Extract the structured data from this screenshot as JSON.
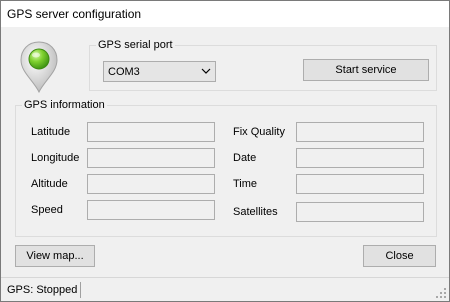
{
  "window": {
    "title": "GPS server configuration"
  },
  "serial": {
    "group_label": "GPS serial port",
    "port_value": "COM3",
    "start_label": "Start service"
  },
  "info": {
    "group_label": "GPS information",
    "left_fields": [
      {
        "label": "Latitude",
        "value": ""
      },
      {
        "label": "Longitude",
        "value": ""
      },
      {
        "label": "Altitude",
        "value": ""
      },
      {
        "label": "Speed",
        "value": ""
      }
    ],
    "right_fields": [
      {
        "label": "Fix Quality",
        "value": ""
      },
      {
        "label": "Date",
        "value": ""
      },
      {
        "label": "Time",
        "value": ""
      },
      {
        "label": "Satellites",
        "value": ""
      }
    ]
  },
  "buttons": {
    "view_map": "View map...",
    "close": "Close"
  },
  "status": {
    "text": "GPS: Stopped"
  },
  "icons": {
    "pin": "map-pin-icon",
    "dropdown": "chevron-down-icon",
    "grip": "resize-grip-icon"
  },
  "colors": {
    "pin_green": "#5fbf1f",
    "pin_gray": "#b8b8b8"
  }
}
